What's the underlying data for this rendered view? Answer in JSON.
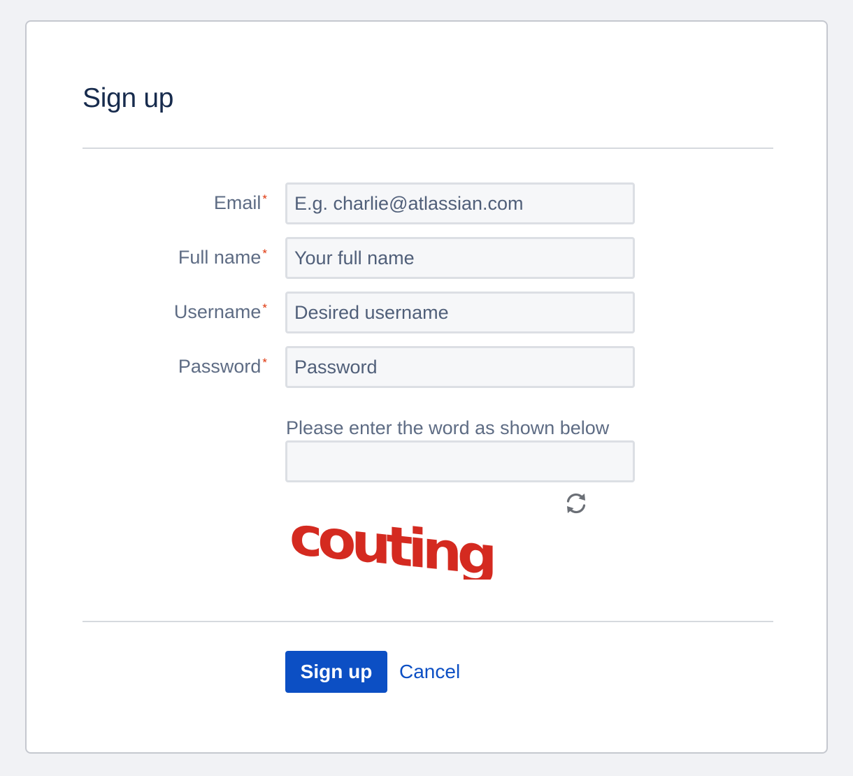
{
  "page": {
    "title": "Sign up"
  },
  "form": {
    "required_marker": "*",
    "email": {
      "label": "Email",
      "placeholder": "E.g. charlie@atlassian.com",
      "value": ""
    },
    "full_name": {
      "label": "Full name",
      "placeholder": "Your full name",
      "value": ""
    },
    "username": {
      "label": "Username",
      "placeholder": "Desired username",
      "value": ""
    },
    "password": {
      "label": "Password",
      "placeholder": "Password",
      "value": ""
    },
    "captcha": {
      "label": "Please enter the word as shown below",
      "value": "",
      "image_word": "couting",
      "image_color": "#d42a20",
      "refresh_icon": "refresh-icon"
    }
  },
  "actions": {
    "submit_label": "Sign up",
    "cancel_label": "Cancel"
  },
  "colors": {
    "primary": "#0c4fc4",
    "required": "#de350b",
    "heading": "#172b4d",
    "label": "#5e6c84"
  }
}
